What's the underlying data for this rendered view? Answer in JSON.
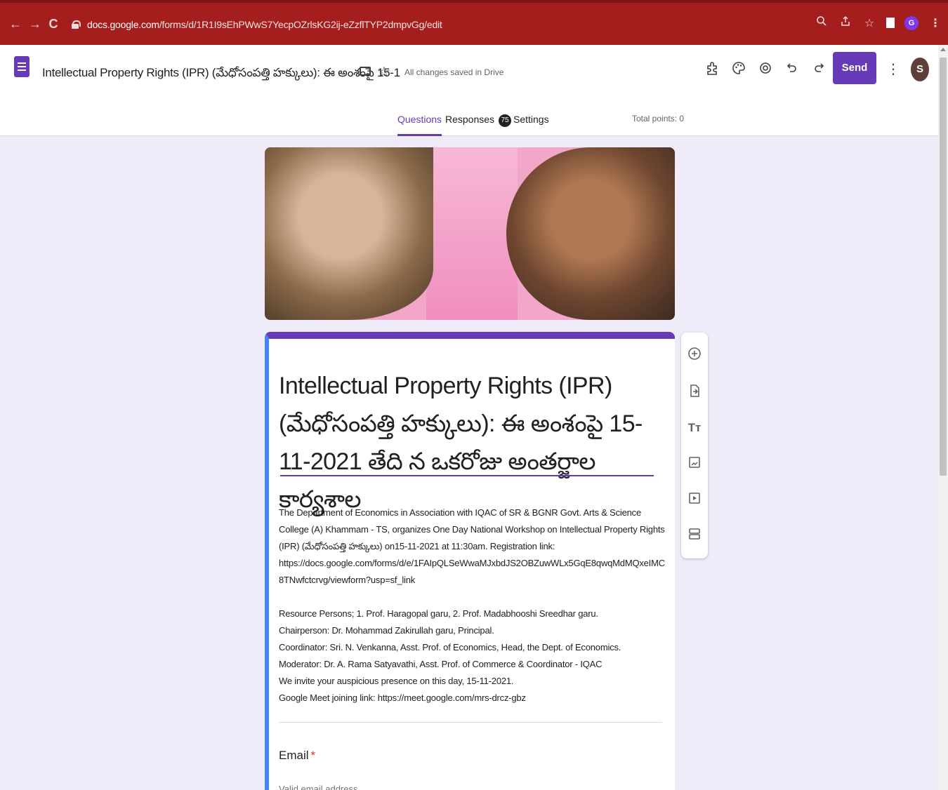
{
  "browser": {
    "back": "←",
    "forward": "→",
    "reload": "C",
    "url_domain": "docs.google.com",
    "url_path": "/forms/d/1R1I9sEhPWwS7YecpOZrlsKG2ij-eZzflTYP2dmpvGg/edit",
    "profile_initial": "G",
    "accent_color": "#a51e1e"
  },
  "header": {
    "doc_title": "Intellectual Property Rights (IPR) (మేధోసంపత్తి హక్కులు): ఈ అంశంపై 15-1",
    "save_status": "All changes saved in Drive",
    "send_label": "Send",
    "avatar_initial": "S",
    "icons": [
      "addon-icon",
      "palette-icon",
      "preview-icon",
      "undo-icon",
      "redo-icon"
    ],
    "brand_color": "#673ab7"
  },
  "tabs": {
    "questions": "Questions",
    "responses": "Responses",
    "responses_count": "75",
    "settings": "Settings",
    "total_points": "Total points: 0"
  },
  "form": {
    "title": "Intellectual Property Rights (IPR) (మేధోసంపత్తి హక్కులు): ఈ అంశంపై 15-11-2021 తేది న ఒకరోజు అంతర్జాల కార్యశాల",
    "description": "The Department of Economics in Association with IQAC of SR & BGNR Govt. Arts & Science College (A) Khammam - TS, organizes One Day National Workshop on Intellectual Property Rights (IPR) (మేధోసంపత్తి హక్కులు) on15-11-2021 at 11:30am. Registration link: https://docs.google.com/forms/d/e/1FAIpQLSeWwaMJxbdJS2OBZuwWLx5GqE8qwqMdMQxeIMC8TNwfctcrvg/viewform?usp=sf_link\n\nResource Persons; 1. Prof. Haragopal garu, 2. Prof. Madabhooshi Sreedhar garu.\nChairperson: Dr. Mohammad Zakirullah garu, Principal.\nCoordinator: Sri. N. Venkanna, Asst. Prof. of Economics, Head, the Dept. of Economics.\nModerator: Dr. A. Rama Satyavathi, Asst. Prof. of Commerce & Coordinator - IQAC\nWe invite your auspicious presence on this day, 15-11-2021.\nGoogle Meet joining link: https://meet.google.com/mrs-drcz-gbz",
    "question_label": "Email",
    "required_mark": "*",
    "question_placeholder": "Valid email address"
  },
  "toolbar": {
    "items": [
      "add-question-icon",
      "import-questions-icon",
      "add-title-icon",
      "add-image-icon",
      "add-video-icon",
      "add-section-icon"
    ],
    "add_title_glyph": "Tт"
  }
}
